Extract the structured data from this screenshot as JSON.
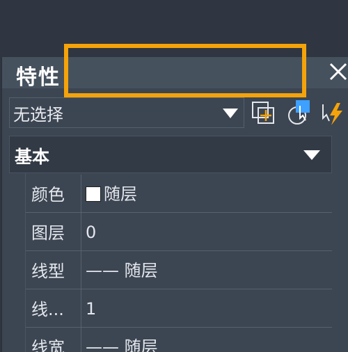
{
  "panel": {
    "title": "特性",
    "close_glyph": "✕"
  },
  "selection": {
    "value": "无选择"
  },
  "toolbar": {
    "icons": [
      "toggle-pickadd-icon",
      "select-objects-icon",
      "quick-select-icon"
    ],
    "accent": "#3ea0ff",
    "lightning_color": "#f5a30a"
  },
  "section": {
    "title": "基本"
  },
  "properties": [
    {
      "label": "颜色",
      "value": "随层",
      "swatch_color": "#ffffff"
    },
    {
      "label": "图层",
      "value": "0"
    },
    {
      "label": "线型",
      "value": "—— 随层"
    },
    {
      "label": "线...",
      "value": "1"
    },
    {
      "label": "线宽",
      "value": "—— 随层"
    }
  ],
  "highlight_color": "#f5a30a"
}
